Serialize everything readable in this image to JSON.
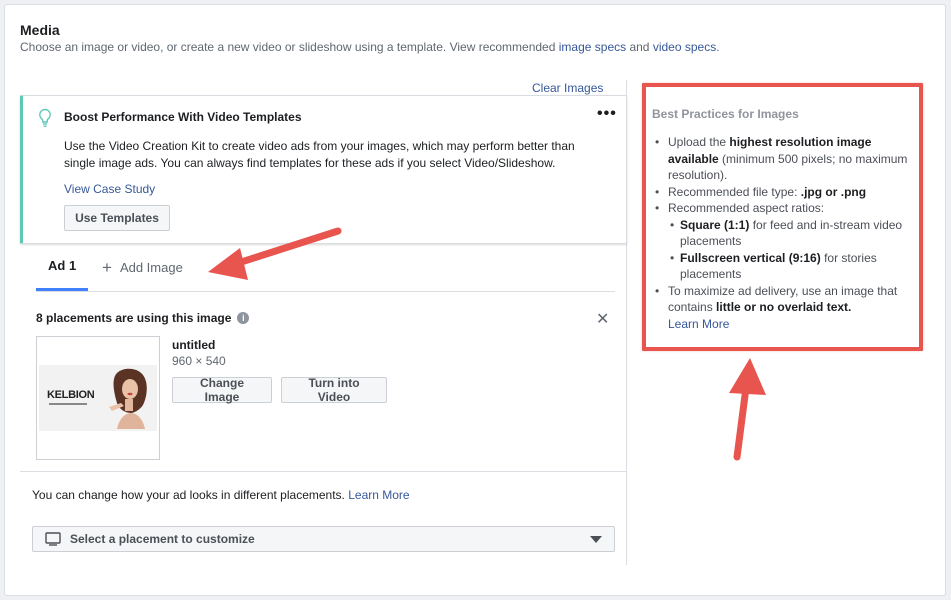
{
  "media": {
    "title": "Media",
    "subtitle_prefix": "Choose an image or video, or create a new video or slideshow using a template. View recommended ",
    "image_specs_link": "image specs",
    "and_text": " and ",
    "video_specs_link": "video specs",
    "period": "."
  },
  "clear_images": "Clear Images",
  "boost": {
    "title": "Boost Performance With Video Templates",
    "more": "•••",
    "body": "Use the Video Creation Kit to create video ads from your images, which may perform better than single image ads. You can always find templates for these ads if you select Video/Slideshow.",
    "case_study_link": "View Case Study",
    "use_templates_button": "Use Templates"
  },
  "tabs": {
    "active": "Ad 1",
    "add_image": "Add Image"
  },
  "placements": {
    "text": "8 placements are using this image",
    "info": "i",
    "close": "✕"
  },
  "file": {
    "name": "untitled",
    "dims": "960 × 540",
    "change_button": "Change Image",
    "video_button": "Turn into Video",
    "thumb_logo": "KELBION"
  },
  "customize": {
    "text": "You can change how your ad looks in different placements.",
    "learn_more": "Learn More",
    "select_label": "Select a placement to customize"
  },
  "best_practices": {
    "title": "Best Practices for Images",
    "item1_pre": "Upload the ",
    "item1_bold": "highest resolution image available",
    "item1_post": " (minimum 500 pixels; no maximum resolution).",
    "item2_pre": "Recommended file type: ",
    "item2_bold": ".jpg or .png",
    "item3": "Recommended aspect ratios:",
    "sub1_bold": "Square (1:1)",
    "sub1_post": " for feed and in-stream video placements",
    "sub2_bold": "Fullscreen vertical (9:16)",
    "sub2_post": " for stories placements",
    "item4_pre": "To maximize ad delivery, use an image that contains ",
    "item4_bold": "little or no overlaid text.",
    "learn_more": "Learn More"
  },
  "colors": {
    "link": "#365899",
    "annotation_red": "#e8544e",
    "tab_blue": "#4080ff",
    "boost_accent": "#5ec8b5"
  }
}
